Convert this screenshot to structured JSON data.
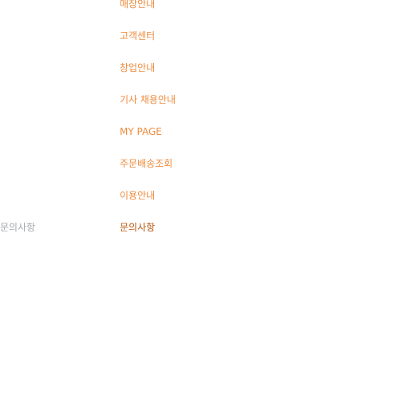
{
  "side_label": "문의사항",
  "menu": {
    "items": [
      {
        "label": "매장안내"
      },
      {
        "label": "고객센터"
      },
      {
        "label": "창업안내"
      },
      {
        "label": "기사 채용안내"
      },
      {
        "label": "MY PAGE"
      },
      {
        "label": "주문배송조회"
      },
      {
        "label": "이용안내"
      },
      {
        "label": "문의사항"
      }
    ],
    "active_index": 7
  },
  "colors": {
    "menu_text": "#ee8c3f",
    "menu_active_text": "#b8560f",
    "side_label_text": "#a3a9ad",
    "background": "#ffffff"
  }
}
